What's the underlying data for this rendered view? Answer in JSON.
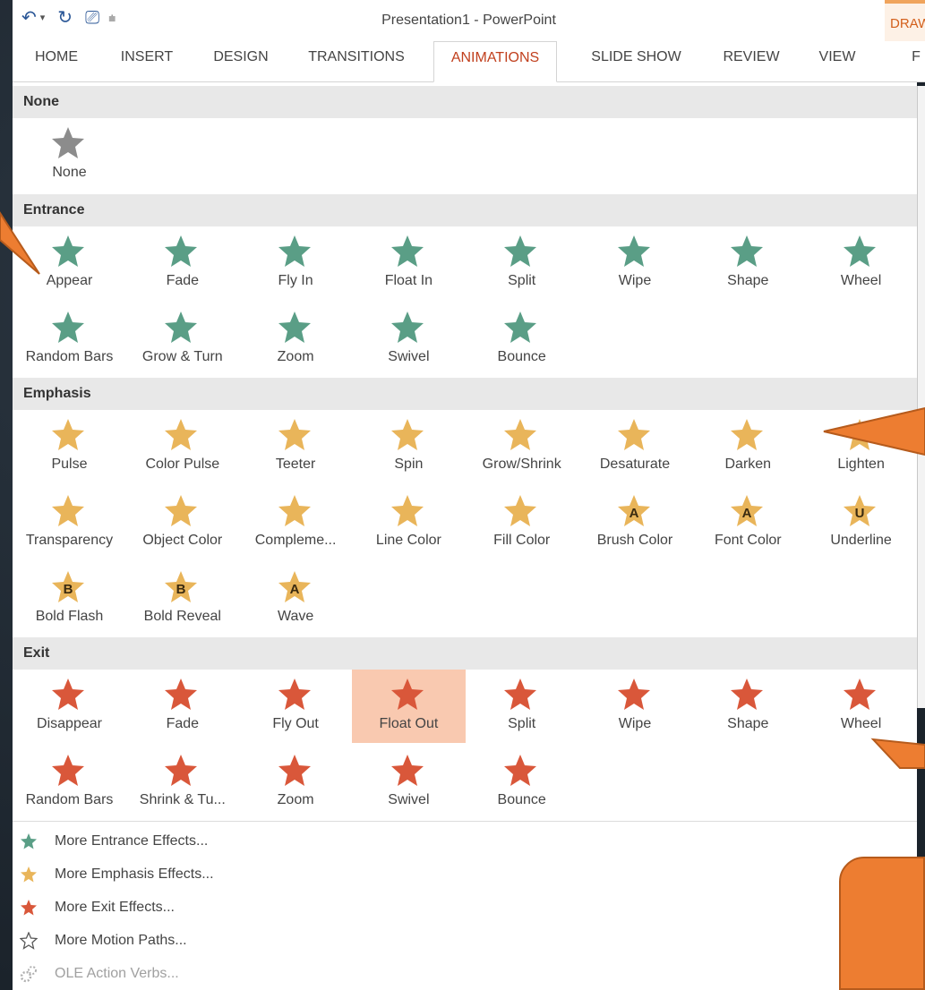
{
  "window": {
    "title": "Presentation1 - PowerPoint",
    "contextual_tab": "DRAWING TOOLS"
  },
  "ribbon": {
    "tabs": [
      {
        "label": "HOME"
      },
      {
        "label": "INSERT"
      },
      {
        "label": "DESIGN"
      },
      {
        "label": "TRANSITIONS"
      },
      {
        "label": "ANIMATIONS",
        "active": true
      },
      {
        "label": "SLIDE SHOW"
      },
      {
        "label": "REVIEW"
      },
      {
        "label": "VIEW"
      },
      {
        "label": "F"
      }
    ]
  },
  "colors": {
    "accent": "#c1401e",
    "entrance": "#5a9e86",
    "emphasis": "#e9b55a",
    "exit": "#d9573a",
    "none": "#8c8c8c",
    "selected": "#f9c9b0",
    "callout": "#ed7d31"
  },
  "gallery": {
    "sections": [
      {
        "title": "None",
        "items": [
          {
            "label": "None"
          }
        ]
      },
      {
        "title": "Entrance",
        "items": [
          {
            "label": "Appear"
          },
          {
            "label": "Fade"
          },
          {
            "label": "Fly In"
          },
          {
            "label": "Float In"
          },
          {
            "label": "Split"
          },
          {
            "label": "Wipe"
          },
          {
            "label": "Shape"
          },
          {
            "label": "Wheel"
          },
          {
            "label": "Random Bars"
          },
          {
            "label": "Grow & Turn"
          },
          {
            "label": "Zoom"
          },
          {
            "label": "Swivel"
          },
          {
            "label": "Bounce"
          }
        ]
      },
      {
        "title": "Emphasis",
        "items": [
          {
            "label": "Pulse"
          },
          {
            "label": "Color Pulse"
          },
          {
            "label": "Teeter"
          },
          {
            "label": "Spin"
          },
          {
            "label": "Grow/Shrink"
          },
          {
            "label": "Desaturate"
          },
          {
            "label": "Darken"
          },
          {
            "label": "Lighten"
          },
          {
            "label": "Transparency"
          },
          {
            "label": "Object Color"
          },
          {
            "label": "Compleme..."
          },
          {
            "label": "Line Color"
          },
          {
            "label": "Fill Color"
          },
          {
            "label": "Brush Color",
            "glyph": "A"
          },
          {
            "label": "Font Color",
            "glyph": "A"
          },
          {
            "label": "Underline",
            "glyph": "U"
          },
          {
            "label": "Bold Flash",
            "glyph": "B"
          },
          {
            "label": "Bold Reveal",
            "glyph": "B"
          },
          {
            "label": "Wave",
            "glyph": "A"
          }
        ]
      },
      {
        "title": "Exit",
        "items": [
          {
            "label": "Disappear"
          },
          {
            "label": "Fade"
          },
          {
            "label": "Fly Out"
          },
          {
            "label": "Float Out",
            "selected": true
          },
          {
            "label": "Split"
          },
          {
            "label": "Wipe"
          },
          {
            "label": "Shape"
          },
          {
            "label": "Wheel"
          },
          {
            "label": "Random Bars"
          },
          {
            "label": "Shrink & Tu..."
          },
          {
            "label": "Zoom"
          },
          {
            "label": "Swivel"
          },
          {
            "label": "Bounce"
          }
        ]
      }
    ]
  },
  "more_options": [
    {
      "label": "More Entrance Effects...",
      "icon": "green-star-icon"
    },
    {
      "label": "More Emphasis Effects...",
      "icon": "gold-star-icon"
    },
    {
      "label": "More Exit Effects...",
      "icon": "red-star-icon"
    },
    {
      "label": "More Motion Paths...",
      "icon": "outline-star-icon"
    },
    {
      "label": "OLE Action Verbs...",
      "icon": "gear-icon",
      "disabled": true
    }
  ]
}
